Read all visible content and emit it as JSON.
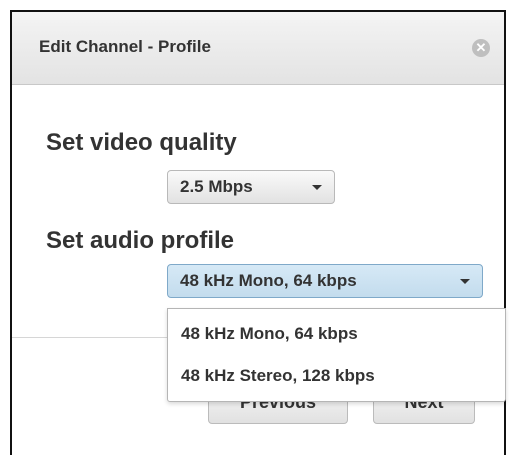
{
  "dialog": {
    "title": "Edit Channel - Profile",
    "close_glyph": "✕"
  },
  "video": {
    "label": "Set video quality",
    "selected": "2.5 Mbps"
  },
  "audio": {
    "label": "Set audio profile",
    "selected": "48 kHz Mono, 64 kbps",
    "options": [
      "48 kHz Mono, 64 kbps",
      "48 kHz Stereo, 128 kbps"
    ]
  },
  "footer": {
    "previous_label": "Previous",
    "next_label": "Next"
  },
  "colors": {
    "active_select_bg": "#cde3f2",
    "active_select_border": "#7fa9c9"
  }
}
